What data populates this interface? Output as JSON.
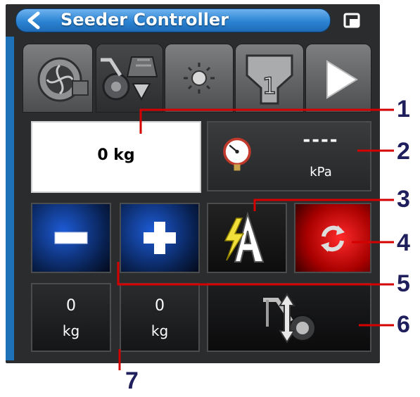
{
  "header": {
    "title": "Seeder Controller"
  },
  "tabs": [
    {
      "name": "fan"
    },
    {
      "name": "seeder-drive"
    },
    {
      "name": "sensor"
    },
    {
      "name": "bin",
      "label": "1"
    },
    {
      "name": "next"
    }
  ],
  "weight": {
    "value": "0 kg"
  },
  "pressure": {
    "value": "----",
    "unit": "kPa"
  },
  "counters": [
    {
      "value": "0",
      "unit": "kg"
    },
    {
      "value": "0",
      "unit": "kg"
    }
  ],
  "callouts": [
    "1",
    "2",
    "3",
    "4",
    "5",
    "6",
    "7"
  ],
  "colors": {
    "accent": "#2b84d3",
    "panel": "#2b2c2e",
    "reset": "#e60000",
    "callout_line": "#d40000",
    "callout_text": "#1f1f5e"
  },
  "icons": [
    "back-arrow-icon",
    "window-toggle-icon",
    "fan-icon",
    "seeder-drive-icon",
    "sensor-icon",
    "bin-icon",
    "next-arrow-icon",
    "pressure-gauge-icon",
    "minus-icon",
    "plus-icon",
    "auto-mode-icon",
    "reset-icon",
    "lift-icon"
  ]
}
